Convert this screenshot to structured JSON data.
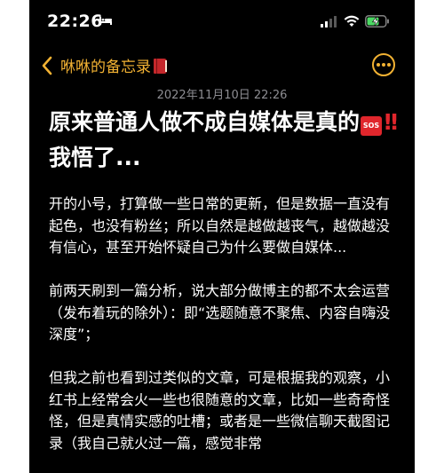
{
  "status_bar": {
    "time": "22:26",
    "icons": [
      "bed-icon",
      "signal-icon",
      "wifi-icon",
      "battery-charging-icon"
    ]
  },
  "nav": {
    "back_label": "咻咻的备忘录",
    "title_icon": "red-book-icon",
    "more_icon": "ellipsis-circle-icon"
  },
  "note": {
    "date": "2022年11月10日 22:26",
    "title_part1": "原来普通人做不成自媒体是真的",
    "title_sos": "SOS",
    "title_bang": "‼️",
    "title_part2": "我悟了...",
    "paragraphs": [
      "开的小号，打算做一些日常的更新，但是数据一直没有起色，也没有粉丝；所以自然是越做越丧气，越做越没有信心，甚至开始怀疑自己为什么要做自媒体...",
      "前两天刷到一篇分析，说大部分做博主的都不太会运营（发布着玩的除外）：即“选题随意不聚焦、内容自嗨没深度”；",
      "但我之前也看到过类似的文章，可是根据我的观察，小红书上经常会火一些也很随意的文章，比如一些奇奇怪怪，但是真情实感的吐槽；或者是一些微信聊天截图记录（我自己就火过一篇，感觉非常"
    ]
  },
  "colors": {
    "background": "#000000",
    "accent": "#f2b233",
    "text": "#ffffff",
    "muted": "#8e8e93",
    "sos_red": "#e0262c"
  }
}
